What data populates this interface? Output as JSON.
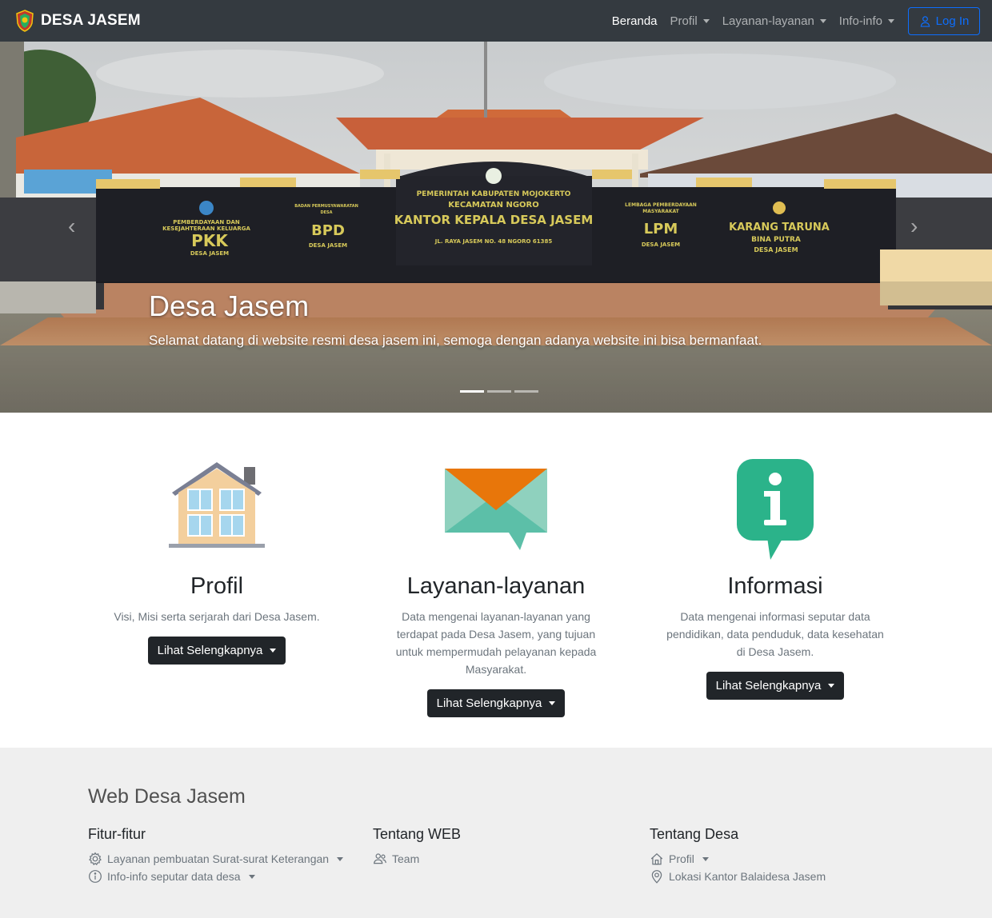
{
  "navbar": {
    "brand": "DESA JASEM",
    "items": [
      {
        "label": "Beranda"
      },
      {
        "label": "Profil"
      },
      {
        "label": "Layanan-layanan"
      },
      {
        "label": "Info-info"
      }
    ],
    "login_label": "Log In"
  },
  "hero": {
    "title": "Desa Jasem",
    "subtitle": "Selamat datang di website resmi desa jasem ini, semoga dengan adanya website ini bisa bermanfaat.",
    "sign_texts": {
      "gov": "PEMERINTAH KABUPATEN MOJOKERTO",
      "kec": "KECAMATAN NGORO",
      "office": "KANTOR KEPALA DESA JASEM",
      "address": "JL. RAYA JASEM NO. 48 NGORO 61385",
      "pkk_top": "PEMBERDAYAAN DAN",
      "pkk_top2": "KESEJAHTERAAN KELUARGA",
      "pkk": "PKK",
      "pkk_sub": "DESA JASEM",
      "bpd_top": "BADAN PERMUSYAWARATAN",
      "bpd_top2": "DESA",
      "bpd": "BPD",
      "bpd_sub": "DESA JASEM",
      "lpm_top": "LEMBAGA PEMBERDAYAAN",
      "lpm_top2": "MASYARAKAT",
      "lpm": "LPM",
      "lpm_sub": "DESA JASEM",
      "kt": "KARANG TARUNA",
      "kt_sub": "BINA PUTRA",
      "kt_sub2": "DESA JASEM"
    },
    "slides": 3,
    "active_slide": 1
  },
  "features": [
    {
      "title": "Profil",
      "description": "Visi, Misi serta serjarah dari Desa Jasem.",
      "button": "Lihat Selengkapnya",
      "icon": "house-icon"
    },
    {
      "title": "Layanan-layanan",
      "description": "Data mengenai layanan-layanan yang terdapat pada Desa Jasem, yang tujuan untuk mempermudah pelayanan kepada Masyarakat.",
      "button": "Lihat Selengkapnya",
      "icon": "envelope-icon"
    },
    {
      "title": "Informasi",
      "description": "Data mengenai informasi seputar data pendidikan, data penduduk, data kesehatan di Desa Jasem.",
      "button": "Lihat Selengkapnya",
      "icon": "info-bubble-icon"
    }
  ],
  "footer": {
    "title": "Web Desa Jasem",
    "columns": [
      {
        "heading": "Fitur-fitur",
        "links": [
          {
            "label": "Layanan pembuatan Surat-surat Keterangan",
            "icon": "gear-icon",
            "dropdown": true
          },
          {
            "label": "Info-info seputar data desa",
            "icon": "info-circle-icon",
            "dropdown": true
          }
        ]
      },
      {
        "heading": "Tentang WEB",
        "links": [
          {
            "label": "Team",
            "icon": "people-icon",
            "dropdown": false
          }
        ]
      },
      {
        "heading": "Tentang Desa",
        "links": [
          {
            "label": "Profil",
            "icon": "home-icon",
            "dropdown": true
          },
          {
            "label": "Lokasi Kantor Balaidesa Jasem",
            "icon": "map-pin-icon",
            "dropdown": false
          }
        ]
      }
    ]
  },
  "colors": {
    "navbar_bg": "#343a40",
    "primary": "#0d6efd",
    "button_dark": "#212529",
    "footer_bg": "#efefef",
    "envelope_orange": "#e8760a",
    "envelope_teal": "#5cbfa8",
    "info_green": "#2bb38a"
  }
}
